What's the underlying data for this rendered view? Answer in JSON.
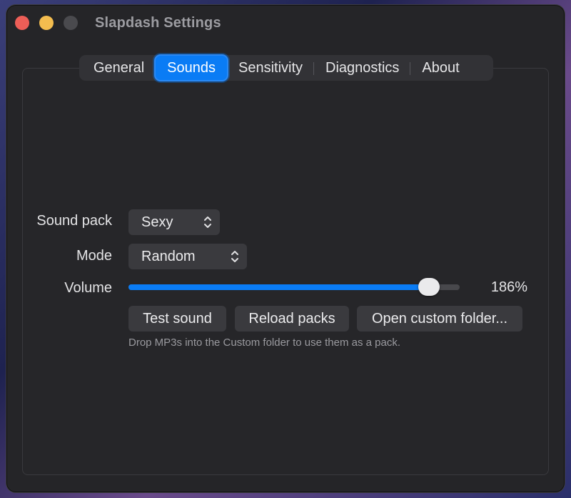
{
  "window": {
    "title": "Slapdash Settings",
    "controls": [
      "close-icon",
      "minimize-icon",
      "zoom-icon"
    ]
  },
  "tabs": [
    {
      "label": "General",
      "active": false
    },
    {
      "label": "Sounds",
      "active": true
    },
    {
      "label": "Sensitivity",
      "active": false
    },
    {
      "label": "Diagnostics",
      "active": false
    },
    {
      "label": "About",
      "active": false
    }
  ],
  "sounds": {
    "sound_pack": {
      "label": "Sound pack",
      "value": "Sexy"
    },
    "mode": {
      "label": "Mode",
      "value": "Random"
    },
    "volume": {
      "label": "Volume",
      "value_text": "186%",
      "fraction": 0.908
    },
    "buttons": {
      "test": "Test sound",
      "reload": "Reload packs",
      "open_folder": "Open custom folder..."
    },
    "hint": "Drop MP3s into the Custom folder to use them as a pack."
  },
  "colors": {
    "accent": "#0a7cf5",
    "close": "#ed5e57",
    "minimize": "#f4bd4f",
    "window_bg": "#252528"
  }
}
